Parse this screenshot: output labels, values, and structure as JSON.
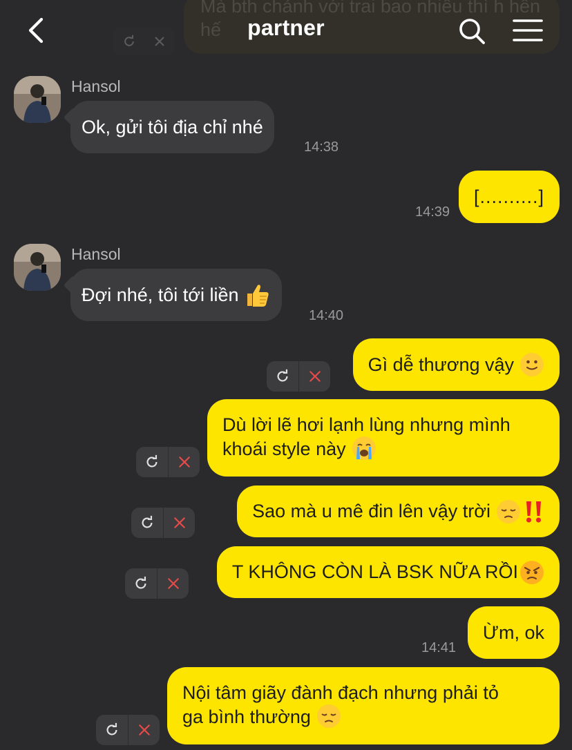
{
  "header": {
    "title": "partner",
    "back_icon": "chevron-left-icon",
    "search_icon": "search-icon",
    "menu_icon": "menu-icon"
  },
  "previous_message": {
    "text": "Mà bth chảnh với trai bao nhiêu thì h hên hế"
  },
  "messages": [
    {
      "direction": "in",
      "sender": "Hansol",
      "text": "Ok, gửi tôi địa chỉ nhé",
      "time": "14:38"
    },
    {
      "direction": "out",
      "text": "[..........]",
      "time": "14:39"
    },
    {
      "direction": "in",
      "sender": "Hansol",
      "text": "Đợi nhé, tôi tới liền",
      "emoji": "thumbs-up-emoji",
      "time": "14:40"
    },
    {
      "direction": "out",
      "text": "Gì dễ thương vậy",
      "emoji": "slightly-smiling-emoji",
      "failed": true
    },
    {
      "direction": "out",
      "lines": [
        "Dù lời lẽ hơi lạnh lùng nhưng mình",
        "khoái style này"
      ],
      "emoji": "crying-emoji",
      "failed": true
    },
    {
      "direction": "out",
      "text": "Sao mà u mê đin lên vậy trời",
      "emoji": "pensive-emoji",
      "extra_emoji": "double-exclamation-emoji",
      "failed": true
    },
    {
      "direction": "out",
      "text": "T KHÔNG CÒN LÀ BSK NỮA RỒI",
      "emoji": "angry-emoji",
      "failed": true
    },
    {
      "direction": "out",
      "text": "Ừm, ok",
      "time": "14:41"
    },
    {
      "direction": "out",
      "lines": [
        "Nội tâm giãy đành đạch nhưng phải tỏ",
        "ga bình thường"
      ],
      "emoji": "pensive-emoji",
      "failed": true
    }
  ],
  "retry_actions": {
    "resend_icon": "refresh-icon",
    "delete_icon": "close-icon"
  },
  "colors": {
    "background": "#2a2a2c",
    "incoming_bubble": "#3c3c3f",
    "outgoing_bubble": "#fee500",
    "delete_red": "#e84a4a"
  }
}
